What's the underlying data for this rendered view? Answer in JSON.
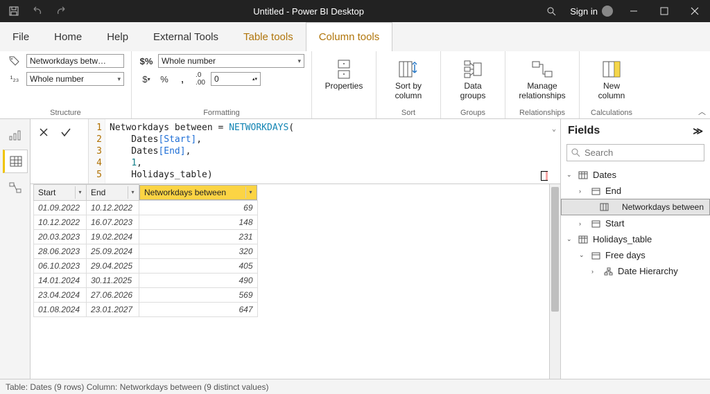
{
  "titlebar": {
    "title": "Untitled - Power BI Desktop",
    "signin": "Sign in"
  },
  "menu": {
    "file": "File",
    "home": "Home",
    "help": "Help",
    "external_tools": "External Tools",
    "table_tools": "Table tools",
    "column_tools": "Column tools"
  },
  "ribbon": {
    "structure": {
      "label": "Structure",
      "name_value": "Networkdays betw…",
      "datatype_value": "Whole number"
    },
    "formatting": {
      "label": "Formatting",
      "format_value": "Whole number",
      "decimals_value": "0"
    },
    "properties": {
      "label": "Properties"
    },
    "sort": {
      "group_label": "Sort",
      "btn": "Sort by\ncolumn"
    },
    "groups": {
      "group_label": "Groups",
      "btn": "Data\ngroups"
    },
    "relationships": {
      "group_label": "Relationships",
      "btn": "Manage\nrelationships"
    },
    "calculations": {
      "group_label": "Calculations",
      "btn": "New\ncolumn"
    }
  },
  "formula": {
    "line1_a": "Networkdays between ",
    "line1_eq": "=",
    "line1_fn": " NETWORKDAYS",
    "line1_paren": "(",
    "line2": "    Dates",
    "line2_b": "[Start]",
    "line2_c": ",",
    "line3": "    Dates",
    "line3_b": "[End]",
    "line3_c": ",",
    "line4a": "    ",
    "line4_num": "1",
    "line4_c": ",",
    "line5": "    Holidays_table",
    "line5_b": ")",
    "gutter": [
      "1",
      "2",
      "3",
      "4",
      "5"
    ]
  },
  "columns": {
    "start": "Start",
    "end": "End",
    "nw": "Networkdays between"
  },
  "rows": [
    {
      "start": "01.09.2022",
      "end": "10.12.2022",
      "nw": "69"
    },
    {
      "start": "10.12.2022",
      "end": "16.07.2023",
      "nw": "148"
    },
    {
      "start": "20.03.2023",
      "end": "19.02.2024",
      "nw": "231"
    },
    {
      "start": "28.06.2023",
      "end": "25.09.2024",
      "nw": "320"
    },
    {
      "start": "06.10.2023",
      "end": "29.04.2025",
      "nw": "405"
    },
    {
      "start": "14.01.2024",
      "end": "30.11.2025",
      "nw": "490"
    },
    {
      "start": "23.04.2024",
      "end": "27.06.2026",
      "nw": "569"
    },
    {
      "start": "01.08.2024",
      "end": "23.01.2027",
      "nw": "647"
    }
  ],
  "fields": {
    "title": "Fields",
    "search_placeholder": "Search",
    "tree": {
      "dates": "Dates",
      "end": "End",
      "nw": "Networkdays between",
      "start": "Start",
      "holidays": "Holidays_table",
      "freedays": "Free days",
      "datehier": "Date Hierarchy"
    }
  },
  "statusbar": "Table: Dates (9 rows) Column: Networkdays between (9 distinct values)",
  "chart_data": {
    "type": "table",
    "columns": [
      "Start",
      "End",
      "Networkdays between"
    ],
    "rows": [
      [
        "01.09.2022",
        "10.12.2022",
        69
      ],
      [
        "10.12.2022",
        "16.07.2023",
        148
      ],
      [
        "20.03.2023",
        "19.02.2024",
        231
      ],
      [
        "28.06.2023",
        "25.09.2024",
        320
      ],
      [
        "06.10.2023",
        "29.04.2025",
        405
      ],
      [
        "14.01.2024",
        "30.11.2025",
        490
      ],
      [
        "23.04.2024",
        "27.06.2026",
        569
      ],
      [
        "01.08.2024",
        "23.01.2027",
        647
      ]
    ]
  }
}
